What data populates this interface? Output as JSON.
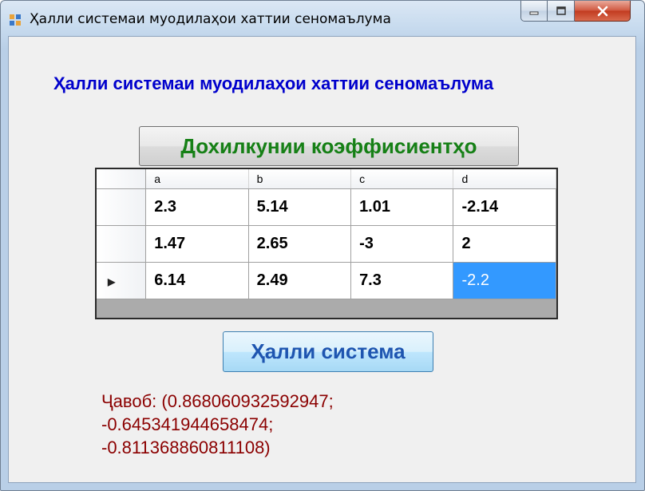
{
  "window": {
    "title": "Ҳалли системаи муодилаҳои хаттии сеномаълума",
    "controls": [
      "minimize",
      "maximize",
      "close"
    ]
  },
  "heading": "Ҳалли системаи муодилаҳои хаттии сеномаълума",
  "input_button_label": "Дохилкунии коэффисиентҳо",
  "grid": {
    "columns": [
      "a",
      "b",
      "c",
      "d"
    ],
    "rows": [
      [
        "2.3",
        "5.14",
        "1.01",
        "-2.14"
      ],
      [
        "1.47",
        "2.65",
        "-3",
        "2"
      ],
      [
        "6.14",
        "2.49",
        "7.3",
        "-2.2"
      ]
    ],
    "current_row_marker": "▶",
    "selected_cell": {
      "row": 2,
      "col": 3
    }
  },
  "solve_button_label": "Ҳалли система",
  "answer": {
    "line1": "Ҷавоб: (0.868060932592947;",
    "line2": "-0.645341944658474;",
    "line3": "-0.811368860811108)"
  },
  "colors": {
    "heading": "#0000cc",
    "input_button_text": "#168016",
    "solve_button_text": "#1e55b0",
    "answer_text": "#8b0000",
    "selection": "#3399ff"
  }
}
